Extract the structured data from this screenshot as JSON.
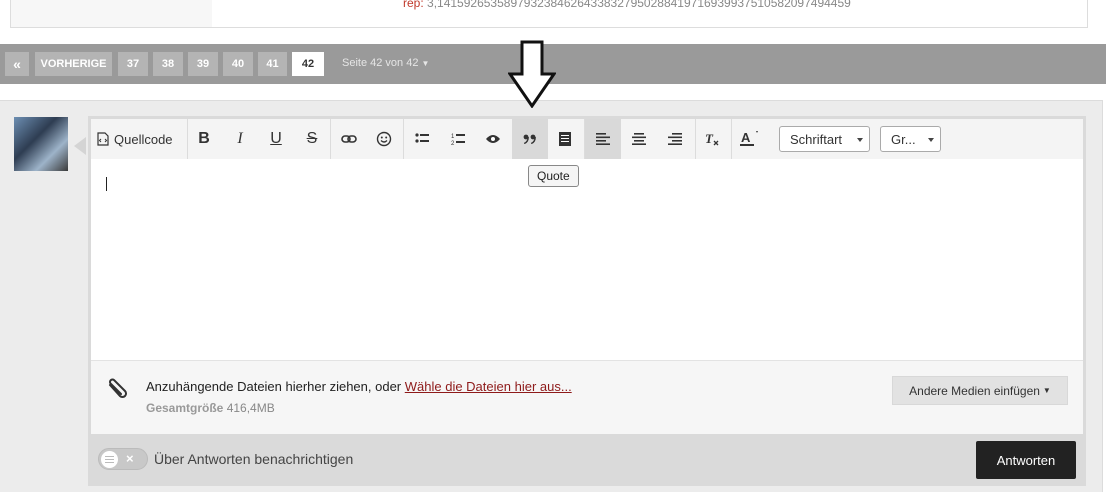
{
  "post": {
    "rep_label": "rep:",
    "rep_value": "3,1415926535897932384626433832795028841971693993751058209749445​9"
  },
  "pagination": {
    "first_icon": "«",
    "prev_label": "VORHERIGE",
    "pages": [
      "37",
      "38",
      "39",
      "40",
      "41",
      "42"
    ],
    "current_page": "42",
    "page_info": "Seite 42 von 42"
  },
  "toolbar": {
    "source_label": "Quellcode",
    "bold": "B",
    "italic": "I",
    "underline": "U",
    "strike": "S",
    "quote_glyph": "99",
    "font_dropdown": "Schriftart",
    "size_dropdown": "Gr..."
  },
  "tooltip": {
    "text": "Quote"
  },
  "attachments": {
    "drop_text": "Anzuhängende Dateien hierher ziehen, oder ",
    "choose_link": "Wähle die Dateien hier aus...",
    "size_label": "Gesamtgröße",
    "size_value": "416,4MB",
    "media_button": "Andere Medien einfügen"
  },
  "footer": {
    "notify_label": "Über Antworten benachrichtigen",
    "toggle_off": "×",
    "submit_label": "Antworten"
  },
  "colors": {
    "pagebar": "#9a9a9a",
    "active_alignment": "#d9d9d9",
    "link": "#8e1a1a",
    "submit": "#222222"
  }
}
